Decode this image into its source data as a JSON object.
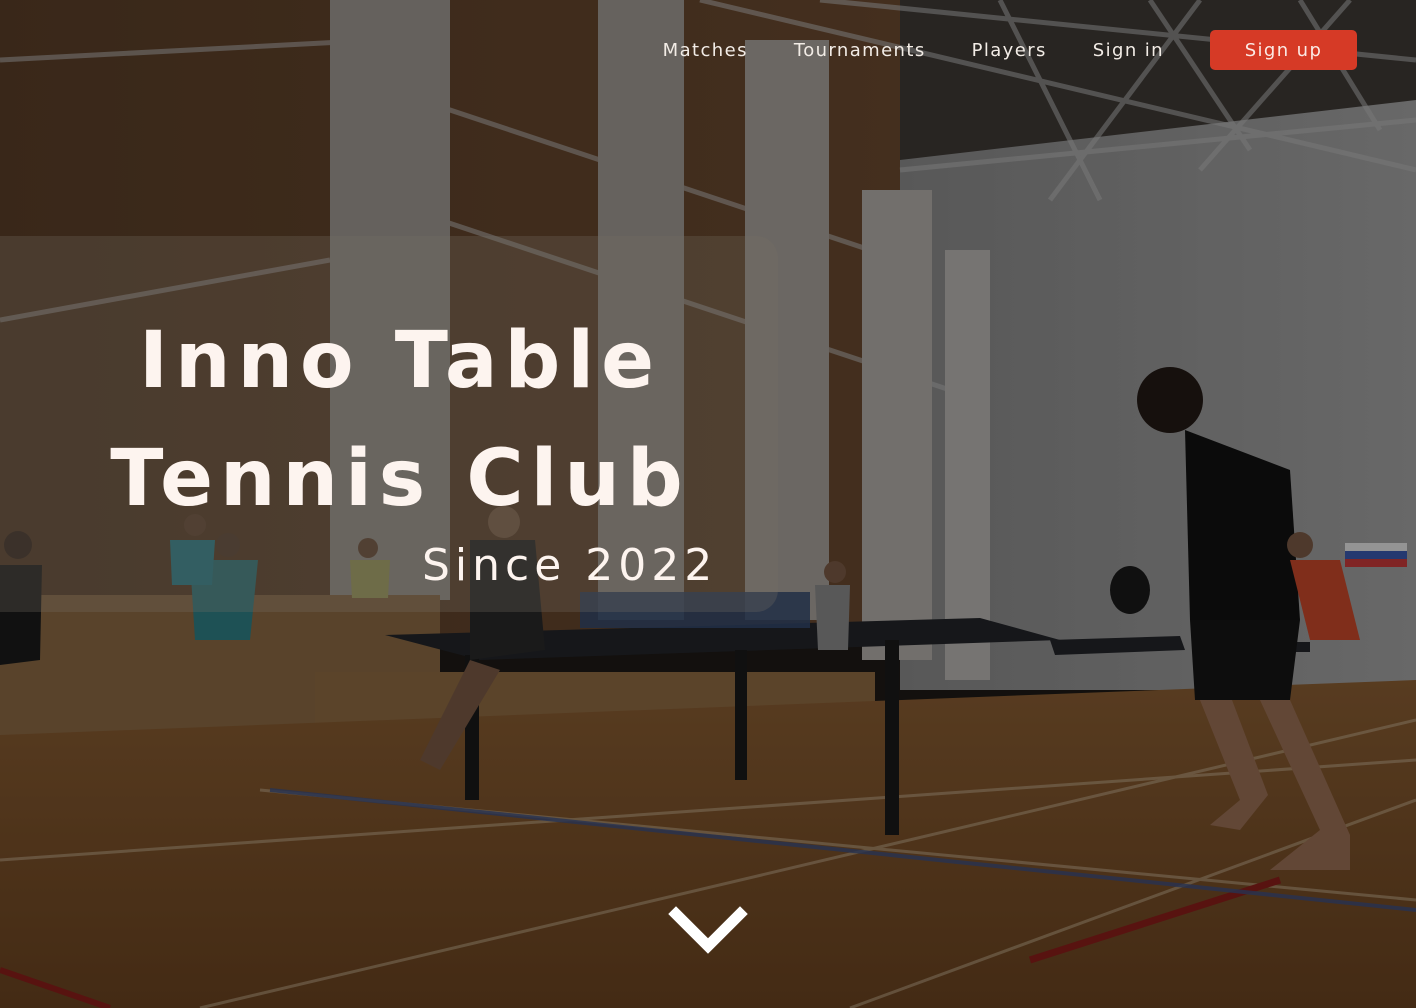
{
  "nav": {
    "links": [
      "Matches",
      "Tournaments",
      "Players",
      "Sign in"
    ],
    "signup_label": "Sign up"
  },
  "hero": {
    "title_line1": "Inno Table",
    "title_line2": "Tennis Club",
    "since": "Since 2022",
    "background": "photo-sports-hall-table-tennis",
    "scroll_icon": "chevron-down-icon"
  },
  "colors": {
    "accent": "#d63a26",
    "title_text": "#fdf4ef",
    "nav_text": "#f2ece6"
  }
}
